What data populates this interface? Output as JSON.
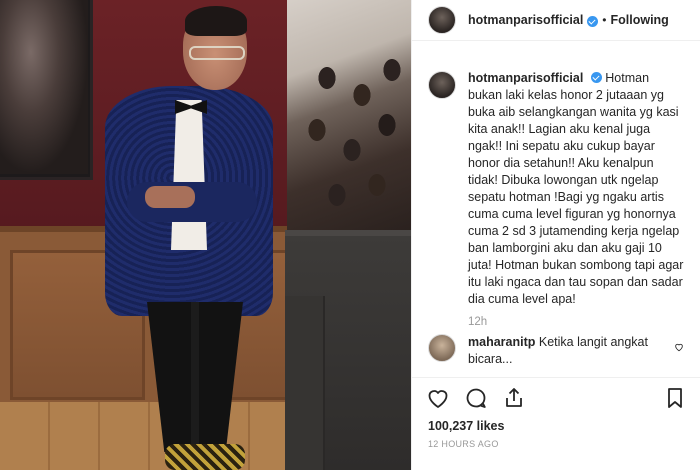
{
  "post": {
    "username": "hotmanparisofficial",
    "follow_label": "Following",
    "separator": "•"
  },
  "caption": {
    "username": "hotmanparisofficial",
    "text": "Hotman bukan laki kelas honor 2 jutaaan yg buka aib selangkangan wanita yg kasi kita anak!! Lagian aku kenal juga ngak!! Ini sepatu aku cukup bayar honor dia setahun!! Aku kenalpun tidak! Dibuka lowongan utk ngelap sepatu hotman !Bagi yg ngaku artis cuma cuma level figuran yg honornya cuma 2 sd 3 jutamending kerja ngelap ban lamborgini aku dan aku gaji 10 juta! Hotman bukan sombong tapi agar itu laki ngaca dan tau sopan dan sadar dia cuma level apa!",
    "time": "12h"
  },
  "comment": {
    "username": "maharanitp",
    "text": "Ketika langit angkat bicara..."
  },
  "stats": {
    "likes": "100,237 likes",
    "posted_ago": "12 HOURS AGO"
  },
  "icons": {
    "verified": "verified-badge-icon",
    "like": "heart-icon",
    "comment": "comment-bubble-icon",
    "share": "share-icon",
    "save": "bookmark-icon"
  },
  "colors": {
    "verified": "#3897f0",
    "muted": "#999999",
    "text": "#262626"
  }
}
